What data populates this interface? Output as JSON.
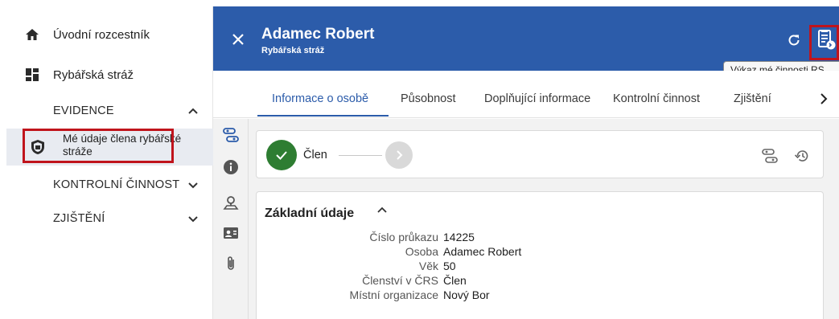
{
  "sidebar": {
    "items": [
      {
        "label": "Úvodní rozcestník",
        "icon": "home-icon"
      },
      {
        "label": "Rybářská stráž",
        "icon": "dashboard-icon"
      }
    ],
    "sections": [
      {
        "label": "EVIDENCE",
        "expanded": true
      },
      {
        "label": "KONTROLNÍ ČINNOST",
        "expanded": false
      },
      {
        "label": "ZJIŠTĚNÍ",
        "expanded": false
      }
    ],
    "selected_item": {
      "label": "Mé údaje člena rybářské stráže",
      "icon": "shield-icon"
    }
  },
  "header": {
    "title": "Adamec Robert",
    "subtitle": "Rybářská stráž",
    "tooltip": "Výkaz mé činnosti RS",
    "background": "#2c5caa"
  },
  "tabs": [
    {
      "label": "Informace o osobě",
      "active": true
    },
    {
      "label": "Působnost",
      "active": false
    },
    {
      "label": "Doplňující informace",
      "active": false
    },
    {
      "label": "Kontrolní činnost",
      "active": false
    },
    {
      "label": "Zjištění",
      "active": false
    }
  ],
  "stepper": {
    "current_label": "Člen",
    "done_color": "#2e7d32"
  },
  "basic_info": {
    "title": "Základní údaje",
    "fields": [
      {
        "label": "Číslo průkazu",
        "value": "14225"
      },
      {
        "label": "Osoba",
        "value": "Adamec Robert"
      },
      {
        "label": "Věk",
        "value": "50"
      },
      {
        "label": "Členství v ČRS",
        "value": "Člen"
      },
      {
        "label": "Místní organizace",
        "value": "Nový Bor"
      }
    ]
  },
  "accent_color": "#2c5caa",
  "highlight_color": "#c0141c"
}
